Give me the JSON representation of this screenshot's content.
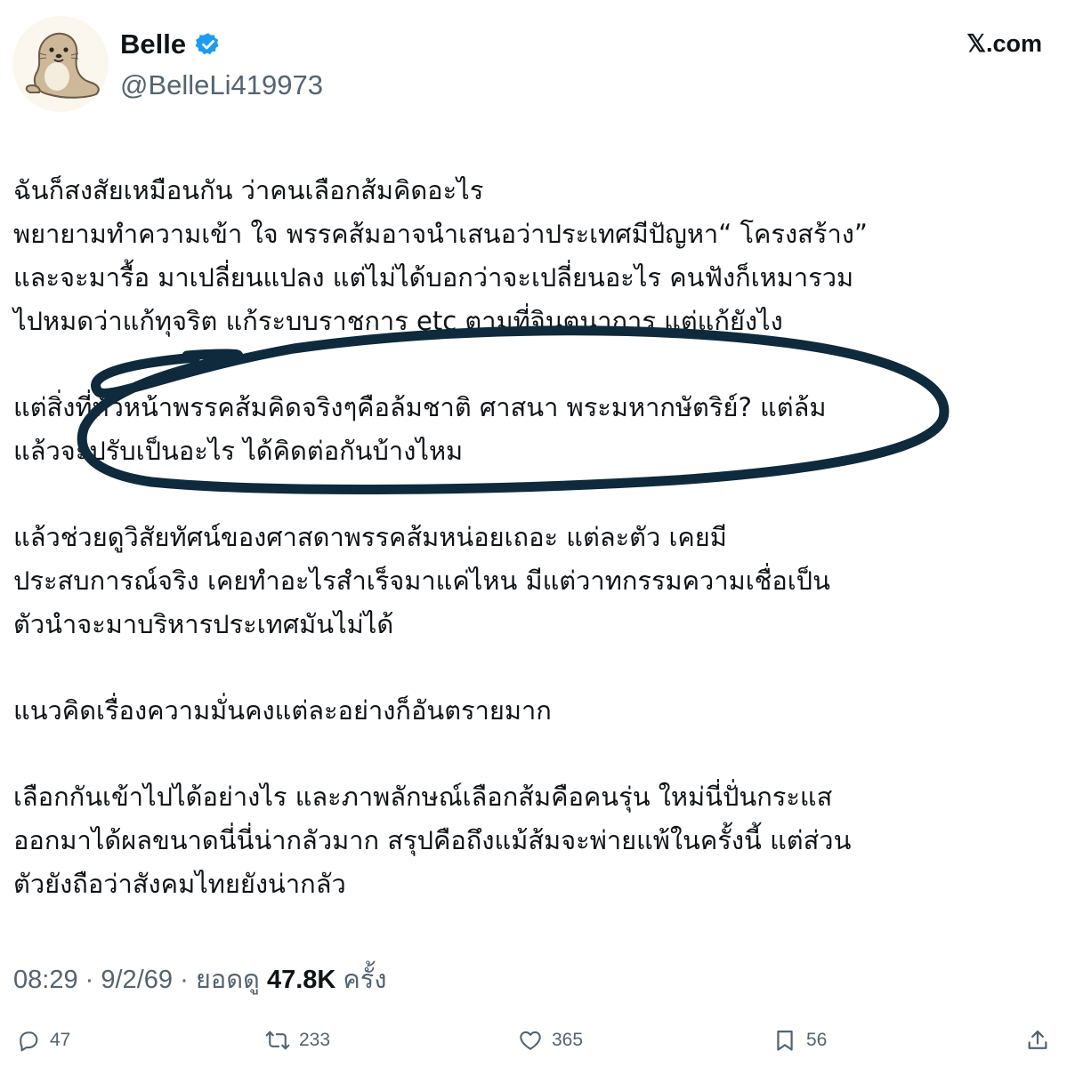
{
  "author": {
    "display_name": "Belle",
    "handle": "@BelleLi419973",
    "verified": true,
    "avatar_icon": "seal-icon"
  },
  "site": {
    "label": "𝕏.com",
    "icon": "x-logo-icon"
  },
  "tweet": {
    "paragraphs": [
      [
        "ฉันก็สงสัยเหมือนกัน ว่าคนเลือกส้มคิดอะไร",
        "พยายามทำความเข้า ใจ พรรคส้มอาจนำเสนอว่าประเทศมีปัญหา“ โครงสร้าง”",
        "และจะมารื้อ มาเปลี่ยนแปลง  แต่ไม่ได้บอกว่าจะเปลี่ยนอะไร  คนฟังก็เหมารวม",
        "ไปหมดว่าแก้ทุจริต แก้ระบบราชการ etc ตามที่จินตนาการ แต่แก้ยังไง"
      ],
      [
        "แต่สิ่งที่หัวหน้าพรรคส้มคิดจริงๆคือล้มชาติ ศาสนา พระมหากษัตริย์?  แต่ล้ม",
        "แล้วจะปรับเป็นอะไร ได้คิดต่อกันบ้างไหม"
      ],
      [
        "แล้วช่วยดูวิสัยทัศน์ของศาสดาพรรคส้มหน่อยเถอะ แต่ละตัว เคยมี",
        "ประสบการณ์จริง เคยทำอะไรสำเร็จมาแค่ไหน  มีแต่วาทกรรมความเชื่อเป็น",
        "ตัวนำจะมาบริหารประเทศมันไม่ได้"
      ],
      [
        "แนวคิดเรื่องความมั่นคงแต่ละอย่างก็อันตรายมาก"
      ],
      [
        "เลือกกันเข้าไปได้อย่างไร  และภาพลักษณ์เลือกส้มคือคนรุ่น ใหม่นี่ปั่นกระแส",
        "ออกมาได้ผลขนาดนี่นี่น่ากลัวมาก สรุปคือถึงแม้ส้มจะพ่ายแพ้ในครั้งนี้ แต่ส่วน",
        "ตัวยังถือว่าสังคมไทยยังน่ากลัว"
      ]
    ],
    "time": "08:29",
    "date": "9/2/69",
    "views_label": "ยอดดู",
    "views_count": "47.8K",
    "views_unit": "ครั้ง",
    "separator": "·"
  },
  "actions": {
    "replies": "47",
    "reposts": "233",
    "likes": "365",
    "bookmarks": "56"
  },
  "colors": {
    "text": "#0f1419",
    "secondary": "#536471",
    "verified": "#1d9bf0",
    "scribble": "#0e2a3c"
  }
}
